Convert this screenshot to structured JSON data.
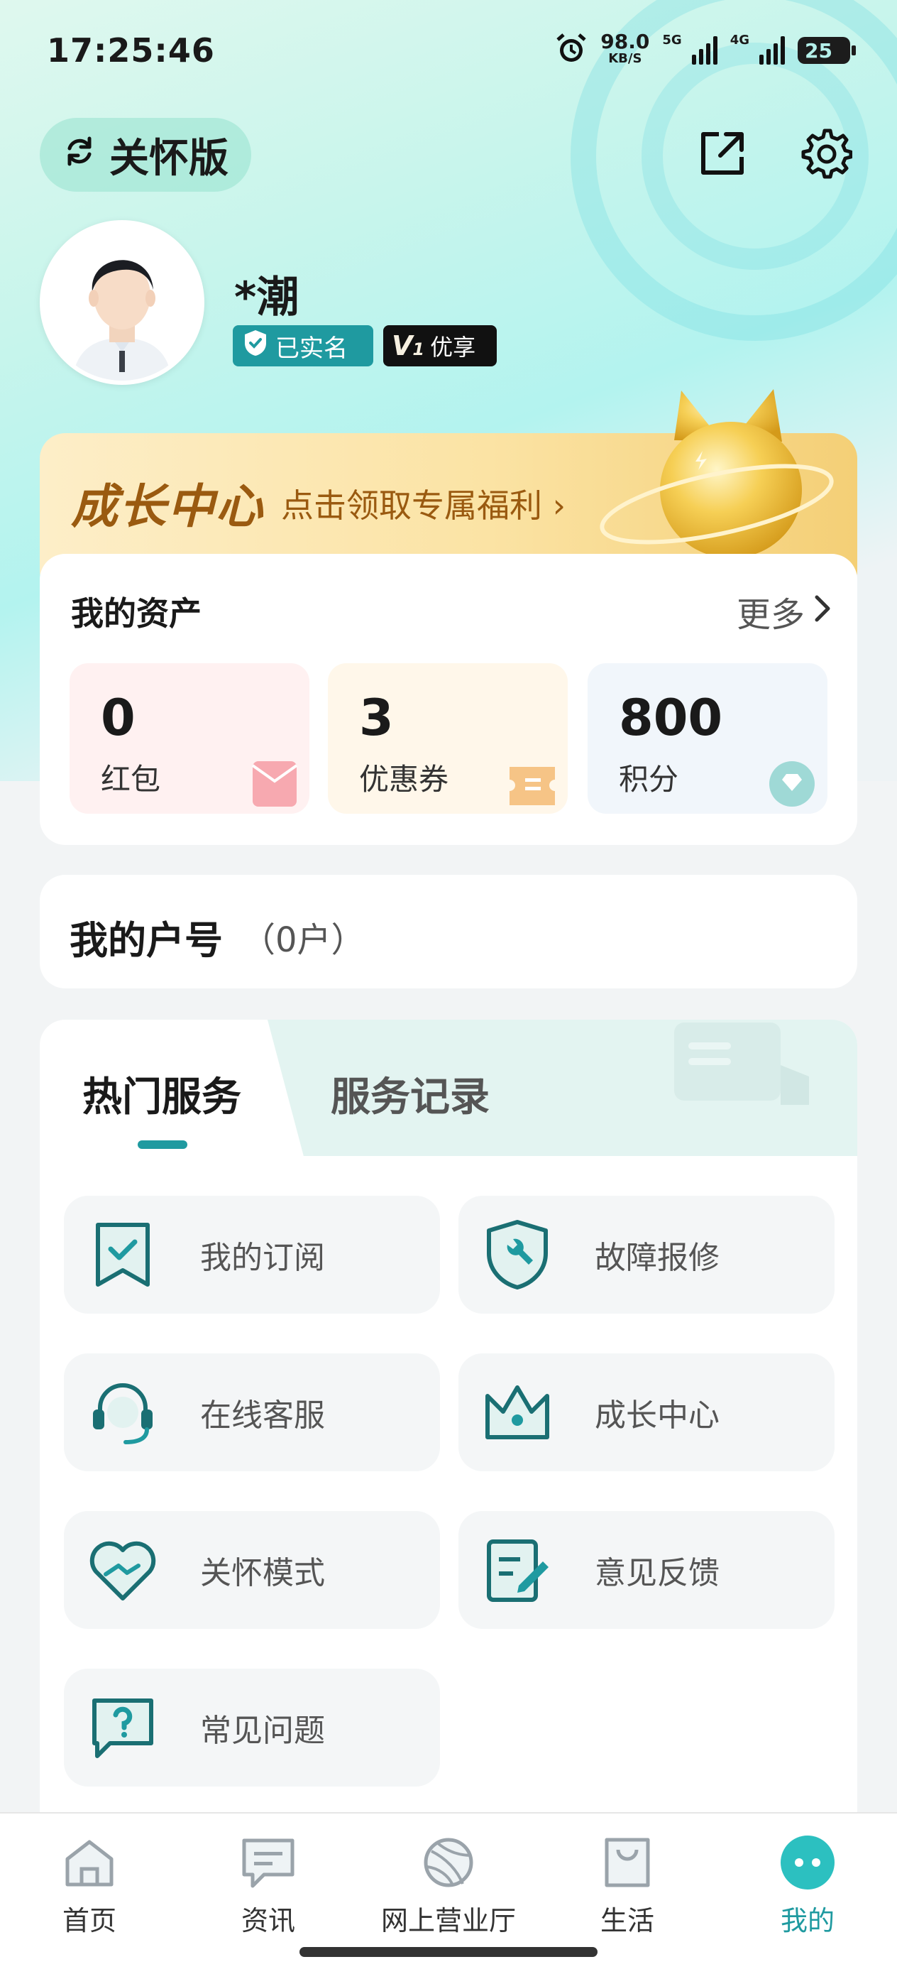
{
  "status_bar": {
    "time": "17:25:46",
    "net_speed": "98.0",
    "net_unit": "KB/S",
    "sig1": "5G",
    "sig2": "4G",
    "battery": "25"
  },
  "header": {
    "care_mode_label": "关怀版",
    "share_icon": "share-icon",
    "settings_icon": "gear-icon"
  },
  "profile": {
    "name": "*潮",
    "verified_label": "已实名",
    "vip_level": "V",
    "vip_level_num": "1",
    "vip_label": "优享"
  },
  "growth_banner": {
    "title": "成长中心",
    "subtitle": "点击领取专属福利 ›"
  },
  "assets": {
    "title": "我的资产",
    "more_label": "更多",
    "items": [
      {
        "value": "0",
        "label": "红包",
        "bg": "#fff1f1",
        "accent": "#f7a9b0"
      },
      {
        "value": "3",
        "label": "优惠券",
        "bg": "#fff7ea",
        "accent": "#f6c486"
      },
      {
        "value": "800",
        "label": "积分",
        "bg": "#f1f6fb",
        "accent": "#9fd9d6"
      }
    ]
  },
  "account": {
    "title": "我的户号",
    "count": "（0户）"
  },
  "services": {
    "tabs": [
      "热门服务",
      "服务记录"
    ],
    "items": [
      {
        "label": "我的订阅",
        "icon": "bookmark-check-icon"
      },
      {
        "label": "故障报修",
        "icon": "wrench-shield-icon"
      },
      {
        "label": "在线客服",
        "icon": "headset-icon"
      },
      {
        "label": "成长中心",
        "icon": "crown-icon"
      },
      {
        "label": "关怀模式",
        "icon": "heart-hands-icon"
      },
      {
        "label": "意见反馈",
        "icon": "edit-doc-icon"
      },
      {
        "label": "常见问题",
        "icon": "question-bubble-icon"
      }
    ]
  },
  "bottom_nav": {
    "items": [
      {
        "label": "首页",
        "icon": "home-icon"
      },
      {
        "label": "资讯",
        "icon": "chat-icon"
      },
      {
        "label": "网上营业厅",
        "icon": "globe-icon"
      },
      {
        "label": "生活",
        "icon": "shopping-bag-icon"
      },
      {
        "label": "我的",
        "icon": "profile-face-icon"
      }
    ],
    "active_index": 4,
    "accent": "#1f9aa0"
  }
}
